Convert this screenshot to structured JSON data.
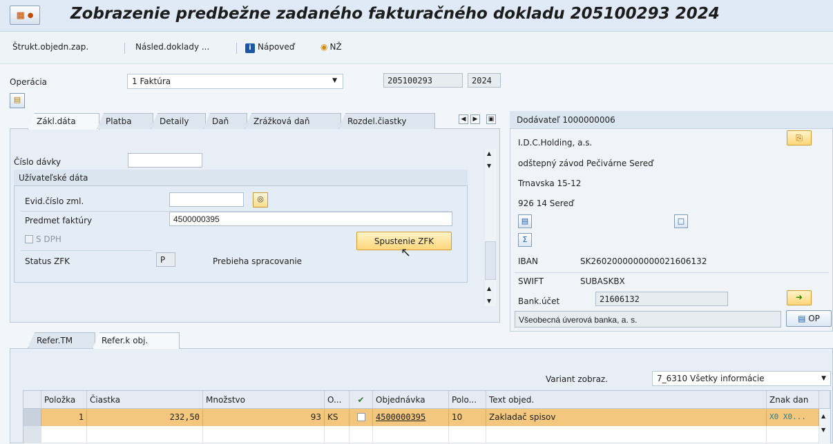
{
  "window": {
    "title": "Zobrazenie predbežne zadaného fakturačného dokladu 205100293 2024",
    "menu_icon": "menu-icon"
  },
  "toolbar": {
    "struct_order": "Štrukt.objedn.zap.",
    "follow_docs": "Násled.doklady ...",
    "help": "Nápoveď",
    "nz": "NŽ"
  },
  "header": {
    "operation_label": "Operácia",
    "operation_value": "1 Faktúra",
    "doc_number": "205100293",
    "year": "2024"
  },
  "tabs": [
    {
      "label": "Zákl.dáta",
      "active": true
    },
    {
      "label": "Platba",
      "active": false
    },
    {
      "label": "Detaily",
      "active": false
    },
    {
      "label": "Daň",
      "active": false
    },
    {
      "label": "Zrážková daň",
      "active": false
    },
    {
      "label": "Rozdel.čiastky",
      "active": false
    }
  ],
  "basic": {
    "batch_label": "Číslo dávky",
    "batch_value": "",
    "user_data_title": "Užívateľské dáta",
    "contract_label": "Evid.číslo zml.",
    "contract_value": "",
    "subject_label": "Predmet faktúry",
    "subject_value": "4500000395",
    "vat_label": "S DPH",
    "start_button": "Spustenie ZFK",
    "status_label": "Status ZFK",
    "status_value": "P",
    "status_text": "Prebieha spracovanie"
  },
  "vendor": {
    "header": "Dodávateľ 1000000006",
    "name": "I.D.C.Holding, a.s.",
    "branch": "odštepný závod Pečivárne Sereď",
    "street": "Trnavska 15-12",
    "city": "926 14 Sereď",
    "iban_label": "IBAN",
    "iban_value": "SK2602000000000021606132",
    "swift_label": "SWIFT",
    "swift_value": "SUBASKBX",
    "account_label": "Bank.účet",
    "account_value": "21606132",
    "bank_name": "Všeobecná úverová banka, a. s.",
    "op_label": "OP"
  },
  "bottom_tabs": [
    {
      "label": "Refer.TM",
      "active": false
    },
    {
      "label": "Refer.k obj.",
      "active": true
    }
  ],
  "variant": {
    "label": "Variant zobraz.",
    "value": "7_6310 Všetky informácie"
  },
  "table": {
    "columns": [
      "Položka",
      "Čiastka",
      "Množstvo",
      "O...",
      "",
      "Objednávka",
      "Polo...",
      "Text objed.",
      "Znak dan"
    ],
    "rows": [
      {
        "item": "1",
        "amount": "232,50",
        "qty": "93",
        "unit": "KS",
        "order": "4500000395",
        "pos": "10",
        "text": "Zakladač spisov",
        "tax": "X0 X0..."
      }
    ]
  },
  "colors": {
    "selected_row": "#f3c77e",
    "accent": "#1a57a6",
    "button_yellow": "#fdd77b"
  }
}
